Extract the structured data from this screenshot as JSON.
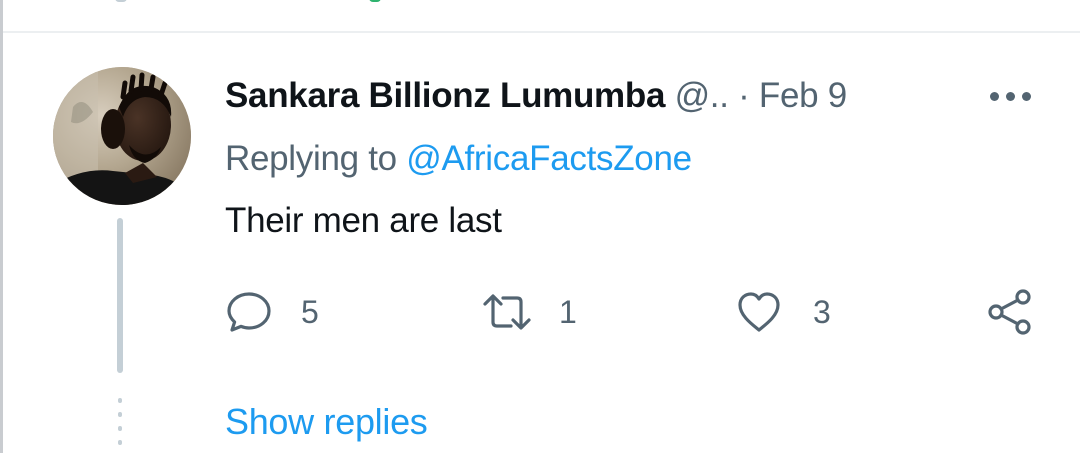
{
  "tweet": {
    "author_name": "Sankara Billionz Lumumba",
    "author_handle": "@..",
    "separator": "·",
    "date": "Feb 9",
    "replying_prefix": "Replying to ",
    "replying_to": "@AfricaFactsZone",
    "text": "Their men are last",
    "avatar_icon": "profile-photo"
  },
  "actions": {
    "reply_count": "5",
    "retweet_count": "1",
    "like_count": "3",
    "reply_icon": "speech-bubble-icon",
    "retweet_icon": "retweet-arrows-icon",
    "like_icon": "heart-icon",
    "share_icon": "share-nodes-icon"
  },
  "thread": {
    "show_replies_label": "Show replies"
  },
  "colors": {
    "text_primary": "#0f1419",
    "text_secondary": "#536471",
    "accent": "#1d9bf0",
    "thread_line": "#c4cfd6",
    "divider": "#eceff1"
  }
}
